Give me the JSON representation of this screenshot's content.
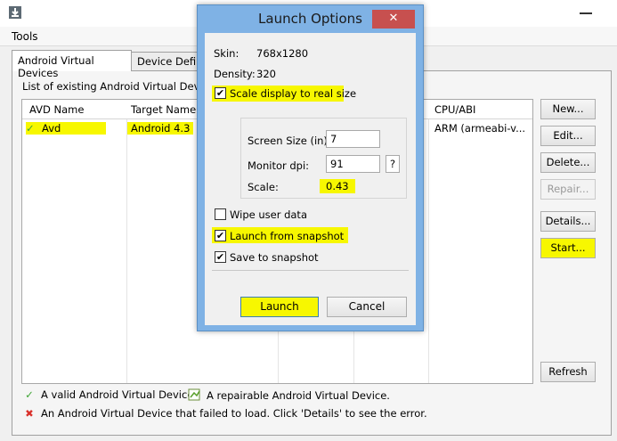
{
  "menu": {
    "tools": "Tools"
  },
  "tabs": [
    {
      "label": "Android Virtual Devices"
    },
    {
      "label": "Device Definitions"
    }
  ],
  "list_label": "List of existing Android Virtual Devices",
  "table": {
    "columns": [
      "AVD Name",
      "Target Name",
      "CPU/ABI"
    ],
    "rows": [
      {
        "avd_name": "Avd",
        "target_name": "Android 4.3",
        "cpu_abi": "ARM (armeabi-v..."
      }
    ]
  },
  "buttons": {
    "new": "New...",
    "edit": "Edit...",
    "delete": "Delete...",
    "repair": "Repair...",
    "details": "Details...",
    "start": "Start...",
    "refresh": "Refresh"
  },
  "legend": {
    "valid": "A valid Android Virtual Device.",
    "repairable": "A repairable Android Virtual Device.",
    "failed": "An Android Virtual Device that failed to load. Click 'Details' to see the error."
  },
  "dialog": {
    "title": "Launch Options",
    "close_glyph": "✕",
    "skin_label": "Skin:",
    "skin_value": "768x1280",
    "density_label": "Density:",
    "density_value": "320",
    "scale_display_label": "Scale display to real size",
    "scale_display_checked": true,
    "screen_size_label": "Screen Size (in):",
    "screen_size_value": "7",
    "monitor_dpi_label": "Monitor dpi:",
    "monitor_dpi_value": "91",
    "dpi_help": "?",
    "scale_label": "Scale:",
    "scale_value": "0.43",
    "wipe_label": "Wipe user data",
    "wipe_checked": false,
    "launch_snapshot_label": "Launch from snapshot",
    "launch_snapshot_checked": true,
    "save_snapshot_label": "Save to snapshot",
    "save_snapshot_checked": true,
    "launch_button": "Launch",
    "cancel_button": "Cancel"
  },
  "colors": {
    "highlight": "#f7f700",
    "dialog_frame": "#7fb2e5",
    "close_button": "#c7504f",
    "valid_icon": "#3fa535",
    "failed_icon": "#d9302a"
  },
  "icons": {
    "app": "android-download-icon",
    "valid": "green-check-icon",
    "repairable": "repair-document-icon",
    "failed": "red-x-icon"
  },
  "glyphs": {
    "check": "✓",
    "cross": "✖",
    "checkbox_mark": "✔"
  }
}
